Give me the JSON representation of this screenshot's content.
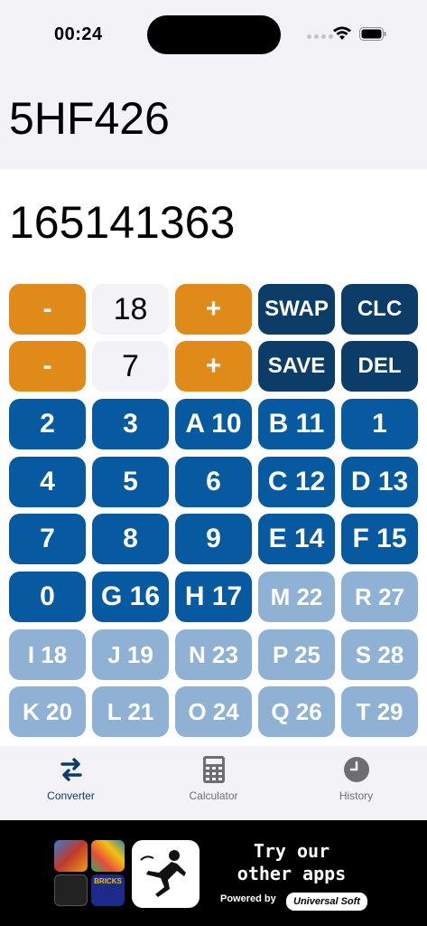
{
  "status_bar": {
    "time": "00:24"
  },
  "display": {
    "input": "5HF426",
    "output": "165141363"
  },
  "controls": {
    "from_base": {
      "minus": "-",
      "value": "18",
      "plus": "+"
    },
    "to_base": {
      "minus": "-",
      "value": "7",
      "plus": "+"
    },
    "swap": "SWAP",
    "clear": "CLC",
    "save": "SAVE",
    "delete": "DEL"
  },
  "digit_keys": [
    "2",
    "3",
    "A 10",
    "B 11",
    "1",
    "4",
    "5",
    "6",
    "C 12",
    "D 13",
    "7",
    "8",
    "9",
    "E 14",
    "F 15",
    "0",
    "G 16",
    "H 17",
    "M 22",
    "R 27",
    "I 18",
    "J 19",
    "N 23",
    "P 25",
    "S 28",
    "K 20",
    "L 21",
    "O 24",
    "Q 26",
    "T 29"
  ],
  "tabs": [
    {
      "label": "Converter",
      "icon": "swap-arrows-icon",
      "active": true
    },
    {
      "label": "Calculator",
      "icon": "calculator-icon",
      "active": false
    },
    {
      "label": "History",
      "icon": "clock-icon",
      "active": false
    }
  ],
  "ad": {
    "headline_line1": "Try our",
    "headline_line2": "other apps",
    "powered_by": "Powered by",
    "brand": "Universal Soft",
    "thumb_text": "BRICKS"
  },
  "colors": {
    "orange": "#df8a19",
    "dark_navy": "#0c3d69",
    "blue": "#075a9f",
    "light_blue": "#8fb1d4"
  }
}
